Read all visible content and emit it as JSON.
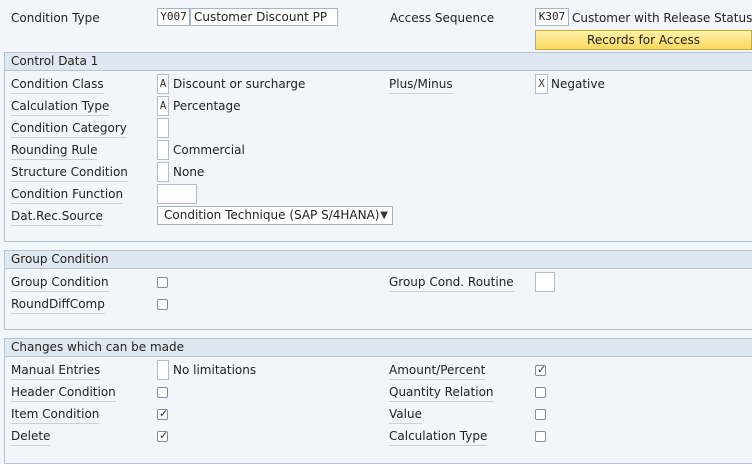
{
  "header": {
    "condition_type_label": "Condition Type",
    "condition_type_code": "Y007",
    "condition_type_desc": "Customer Discount PP",
    "access_sequence_label": "Access Sequence",
    "access_sequence_code": "K307",
    "access_sequence_desc": "Customer with Release Status",
    "records_button": "Records for Access"
  },
  "control_data": {
    "title": "Control Data 1",
    "condition_class_label": "Condition Class",
    "condition_class_code": "A",
    "condition_class_desc": "Discount or surcharge",
    "calculation_type_label": "Calculation Type",
    "calculation_type_code": "A",
    "calculation_type_desc": "Percentage",
    "condition_category_label": "Condition Category",
    "rounding_rule_label": "Rounding Rule",
    "rounding_rule_desc": "Commercial",
    "structure_condition_label": "Structure Condition",
    "structure_condition_desc": "None",
    "condition_function_label": "Condition Function",
    "dat_rec_source_label": "Dat.Rec.Source",
    "dat_rec_source_value": "Condition Technique (SAP S/4HANA)",
    "plus_minus_label": "Plus/Minus",
    "plus_minus_code": "X",
    "plus_minus_desc": "Negative"
  },
  "group_condition": {
    "title": "Group Condition",
    "group_condition_label": "Group Condition",
    "group_condition_checked": false,
    "round_diff_comp_label": "RoundDiffComp",
    "round_diff_comp_checked": false,
    "group_cond_routine_label": "Group Cond. Routine"
  },
  "changes": {
    "title": "Changes which can be made",
    "manual_entries_label": "Manual Entries",
    "manual_entries_desc": "No limitations",
    "header_condition_label": "Header Condition",
    "header_condition_checked": false,
    "item_condition_label": "Item Condition",
    "item_condition_checked": true,
    "delete_label": "Delete",
    "delete_checked": true,
    "amount_percent_label": "Amount/Percent",
    "amount_percent_checked": true,
    "quantity_relation_label": "Quantity Relation",
    "quantity_relation_checked": false,
    "value_label": "Value",
    "value_checked": false,
    "calculation_type_label": "Calculation Type",
    "calculation_type_checked": false
  }
}
